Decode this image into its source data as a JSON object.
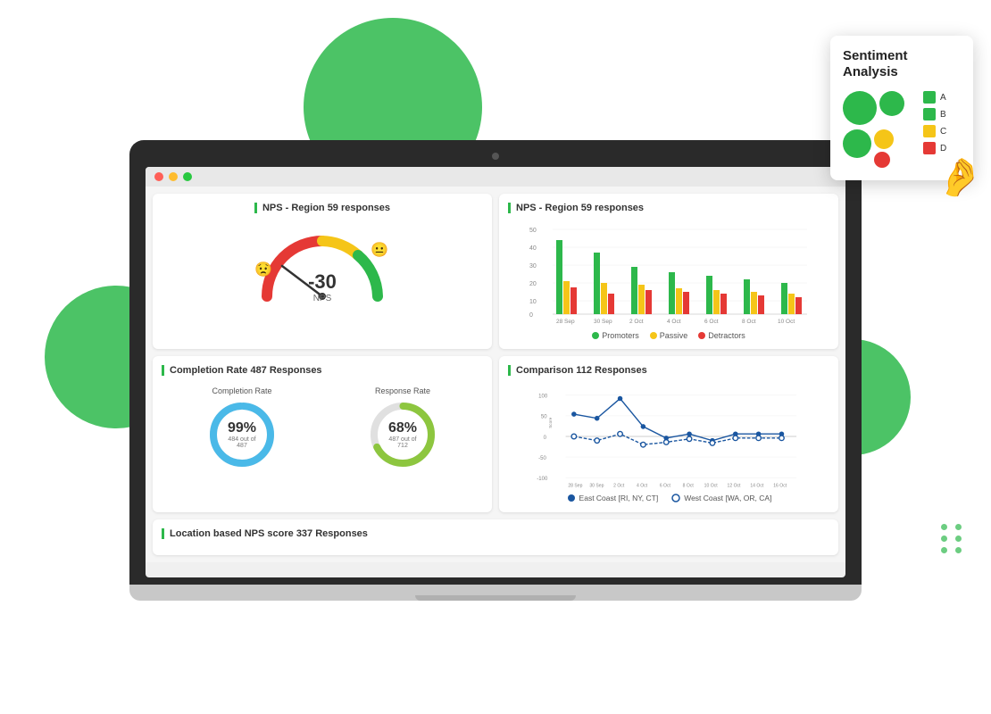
{
  "background": {
    "circles": [
      "top-center",
      "left-middle",
      "right-middle"
    ]
  },
  "sentiment_card": {
    "title": "Sentiment\nAnalysis",
    "legend": [
      {
        "label": "A",
        "color": "#2db84b"
      },
      {
        "label": "B",
        "color": "#2db84b"
      },
      {
        "label": "C",
        "color": "#f5c518"
      },
      {
        "label": "D",
        "color": "#e53935"
      }
    ]
  },
  "nps_gauge": {
    "title": "NPS - Region 59 responses",
    "value": "-30",
    "label": "NPS"
  },
  "nps_bar": {
    "title": "NPS - Region 59 responses",
    "dates": [
      "28 Sep",
      "30 Sep",
      "2 Oct",
      "4 Oct",
      "6 Oct",
      "8 Oct",
      "10 Oct"
    ],
    "legend": [
      "Promoters",
      "Passive",
      "Detractors"
    ],
    "colors": [
      "#2db84b",
      "#f5c518",
      "#e53935"
    ]
  },
  "completion": {
    "title": "Completion Rate 487 Responses",
    "completion_rate": {
      "label": "Completion Rate",
      "percent": "99%",
      "sub": "484 out of 487",
      "color": "#4ab9e8"
    },
    "response_rate": {
      "label": "Response Rate",
      "percent": "68%",
      "sub": "487 out of 712",
      "color": "#8dc63f"
    }
  },
  "comparison": {
    "title": "Comparison 112 Responses",
    "y_labels": [
      "100",
      "50",
      "0",
      "-50",
      "-100"
    ],
    "x_labels": [
      "28 Sep",
      "30 Sep",
      "2 Oct",
      "4 Oct",
      "6 Oct",
      "8 Oct",
      "10 Oct",
      "12 Oct",
      "14 Oct",
      "16 Oct"
    ],
    "legend": [
      {
        "label": "East Coast [RI, NY, CT]",
        "color": "#1a56a0"
      },
      {
        "label": "West Coast [WA, OR, CA]",
        "color": "#1a56a0"
      }
    ]
  },
  "location": {
    "title": "Location based NPS score 337 Responses"
  }
}
